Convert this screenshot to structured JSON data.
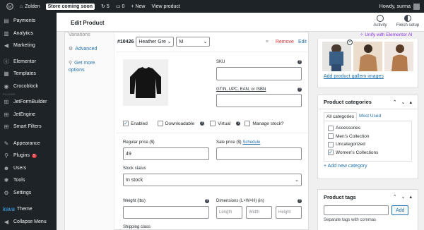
{
  "adminbar": {
    "site_name": "Zolden",
    "store_badge": "Store coming soon",
    "updates_count": "5",
    "comments_count": "0",
    "new_label": "New",
    "view_label": "View product",
    "greeting": "Howdy, surma"
  },
  "sidebar": {
    "items": [
      {
        "label": "Payments",
        "icon": "payments-icon"
      },
      {
        "label": "Analytics",
        "icon": "analytics-icon"
      },
      {
        "label": "Marketing",
        "icon": "marketing-icon"
      },
      {
        "label": "Elementor",
        "icon": "elementor-icon"
      },
      {
        "label": "Templates",
        "icon": "templates-icon"
      },
      {
        "label": "Crocoblock",
        "icon": "crocoblock-icon"
      },
      {
        "label": "JetFormBuilder",
        "icon": "jetformbuilder-icon"
      },
      {
        "label": "JetEngine",
        "icon": "jetengine-icon"
      },
      {
        "label": "Smart Filters",
        "icon": "smart-filters-icon"
      },
      {
        "label": "Appearance",
        "icon": "appearance-icon"
      },
      {
        "label": "Plugins",
        "icon": "plugins-icon",
        "badge": "5"
      },
      {
        "label": "Users",
        "icon": "users-icon"
      },
      {
        "label": "Tools",
        "icon": "tools-icon"
      },
      {
        "label": "Settings",
        "icon": "settings-icon"
      },
      {
        "label": "Theme",
        "icon": "theme-icon",
        "prefix": "kava"
      },
      {
        "label": "Collapse Menu",
        "icon": "collapse-icon"
      }
    ],
    "separator_label": "PLUGINS"
  },
  "header": {
    "title": "Edit Product",
    "activity_label": "Activity",
    "finish_setup_label": "Finish setup"
  },
  "product_data": {
    "tabs": [
      {
        "label": "Variations"
      },
      {
        "label": "Advanced"
      },
      {
        "label": "Get more options"
      }
    ],
    "variation": {
      "id": "#10426",
      "color_value": "Heather Gre",
      "size_value": "M",
      "remove_label": "Remove",
      "edit_label": "Edit"
    },
    "fields": {
      "sku_label": "SKU",
      "gtin_label": "GTIN, UPC, EAN, or ISBN",
      "enabled_label": "Enabled",
      "downloadable_label": "Downloadable",
      "virtual_label": "Virtual",
      "manage_stock_label": "Manage stock?",
      "regular_price_label": "Regular price ($)",
      "regular_price_value": "49",
      "sale_price_label": "Sale price ($)",
      "schedule_label": "Schedule",
      "stock_status_label": "Stock status",
      "stock_status_value": "In stock",
      "weight_label": "Weight (lbs)",
      "dimensions_label": "Dimensions (L×W×H) (in)",
      "length_ph": "Length",
      "width_ph": "Width",
      "height_ph": "Height",
      "shipping_class_label": "Shipping class"
    }
  },
  "right": {
    "elementor_ai_label": "Unify with Elementor AI",
    "add_gallery_label": "Add product gallery images",
    "categories": {
      "title": "Product categories",
      "tab_all": "All categories",
      "tab_most_used": "Most Used",
      "items": [
        {
          "label": "Accessories",
          "checked": false
        },
        {
          "label": "Men's Collection",
          "checked": false
        },
        {
          "label": "Uncategorized",
          "checked": false
        },
        {
          "label": "Women's Collections",
          "checked": true
        }
      ],
      "add_new_label": "+ Add new category"
    },
    "tags": {
      "title": "Product tags",
      "add_button": "Add",
      "hint": "Separate tags with commas"
    }
  },
  "colors": {
    "admin_dark": "#1d2327",
    "link_blue": "#2271b1",
    "danger_red": "#d63638",
    "elementor_purple": "#8c2ff1"
  }
}
